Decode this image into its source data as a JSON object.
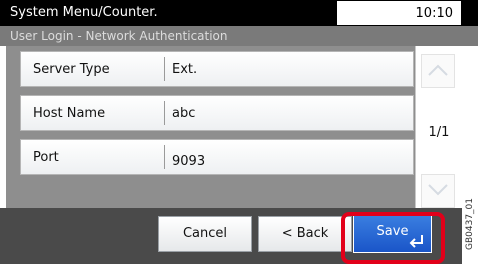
{
  "header": {
    "title": "System Menu/Counter.",
    "time": "10:10"
  },
  "subheader": {
    "title": "User Login - Network Authentication"
  },
  "settings": [
    {
      "label": "Server Type",
      "value": "Ext."
    },
    {
      "label": "Host Name",
      "value": "abc"
    },
    {
      "label": "Port",
      "value": "9093"
    }
  ],
  "pager": {
    "indicator": "1/1"
  },
  "footer": {
    "cancel_label": "Cancel",
    "back_label": "< Back",
    "save_label": "Save"
  },
  "figure_code": "GB0437_01",
  "colors": {
    "save_button": "#1a55c8",
    "highlight": "#e2001a",
    "title_bar": "#000000"
  },
  "icons": {
    "scroll_up": "chevron-up-icon",
    "scroll_down": "chevron-down-icon",
    "save": "enter-icon"
  }
}
